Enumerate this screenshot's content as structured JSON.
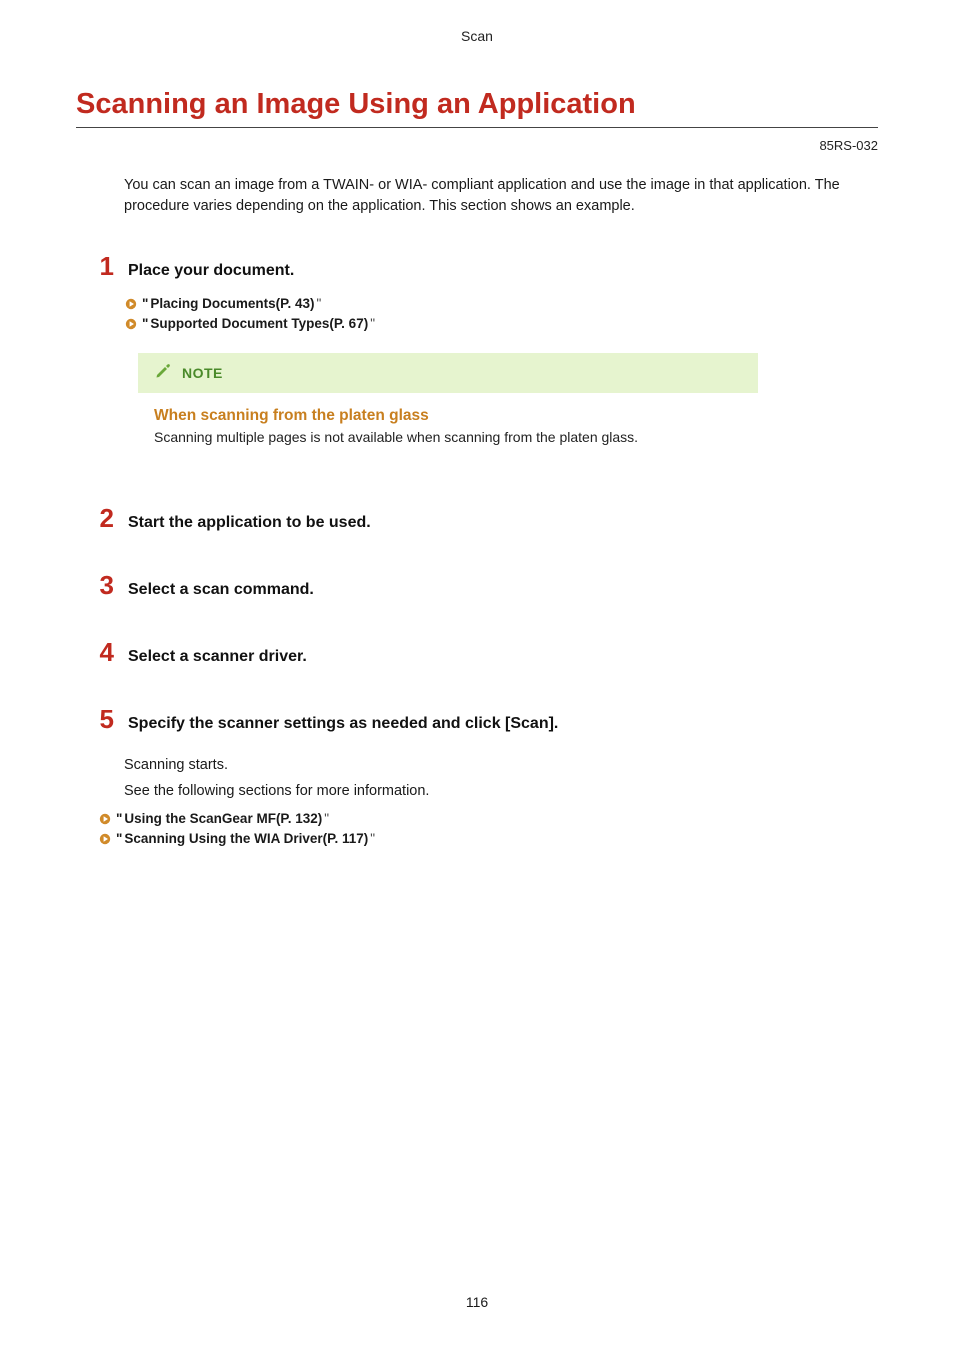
{
  "header_section": "Scan",
  "title": "Scanning an Image Using an Application",
  "doc_id": "85RS-032",
  "intro": "You can scan an image from a TWAIN- or WIA- compliant application and use the image in that application. The procedure varies depending on the application. This section shows an example.",
  "steps": {
    "s1": {
      "num": "1",
      "text": "Place your document."
    },
    "s2": {
      "num": "2",
      "text": "Start the application to be used."
    },
    "s3": {
      "num": "3",
      "text": "Select a scan command."
    },
    "s4": {
      "num": "4",
      "text": "Select a scanner driver."
    },
    "s5": {
      "num": "5",
      "text": "Specify the scanner settings as needed and click [Scan]."
    }
  },
  "links1": {
    "a": {
      "q": "\"",
      "text": "Placing Documents(P. 43)",
      "close": " \""
    },
    "b": {
      "q": "\"",
      "text": "Supported Document Types(P. 67)",
      "close": " \""
    }
  },
  "note": {
    "label": "NOTE",
    "title": "When scanning from the platen glass",
    "text": "Scanning multiple pages is not available when scanning from the platen glass."
  },
  "after": {
    "l1": "Scanning starts.",
    "l2": "See the following sections for more information."
  },
  "links2": {
    "a": {
      "q": "\"",
      "text": "Using the ScanGear MF(P. 132)",
      "close": " \""
    },
    "b": {
      "q": "\"",
      "text": "Scanning Using the WIA Driver(P. 117)",
      "close": " \""
    }
  },
  "page_number": "116"
}
